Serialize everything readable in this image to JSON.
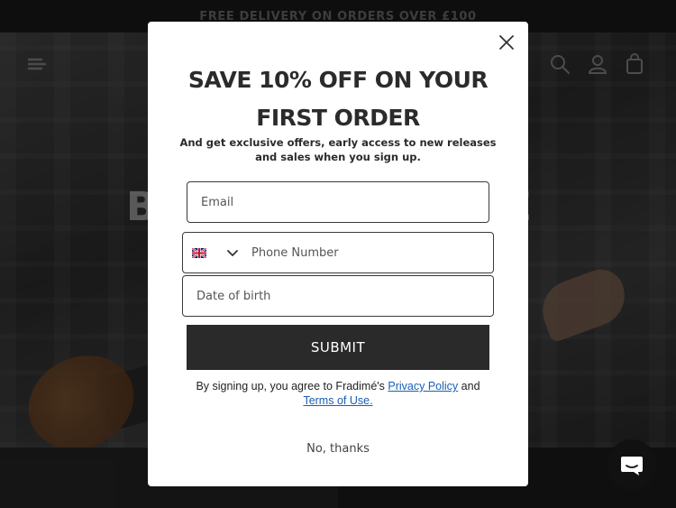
{
  "announcement": {
    "text": "FREE DELIVERY ON ORDERS OVER £100"
  },
  "hero": {
    "left_text": "B",
    "right_text": "E"
  },
  "header": {
    "menu_icon": "menu-icon",
    "search_icon": "search-icon",
    "account_icon": "account-icon",
    "cart_icon": "cart-icon"
  },
  "popup": {
    "title_line1": "SAVE 10% OFF ON YOUR",
    "title_line2": "FIRST ORDER",
    "subtitle": "And get exclusive offers, early access to new releases and sales when you sign up.",
    "email_placeholder": "Email",
    "phone_country_flag": "uk-flag-icon",
    "phone_placeholder": "Phone Number",
    "dob_placeholder": "Date of birth",
    "submit_label": "SUBMIT",
    "terms_prefix": "By signing up, you agree to Fradimé's ",
    "privacy_link": "Privacy Policy",
    "terms_and": " and",
    "terms_link": " Terms of Use.",
    "no_thanks": "No, thanks",
    "close_icon": "close-icon"
  },
  "chat": {
    "icon": "chat-icon"
  },
  "colors": {
    "button_bg": "#2a2a2a",
    "link": "#1a5fb4",
    "announcement_bg": "#1a1a1a"
  }
}
